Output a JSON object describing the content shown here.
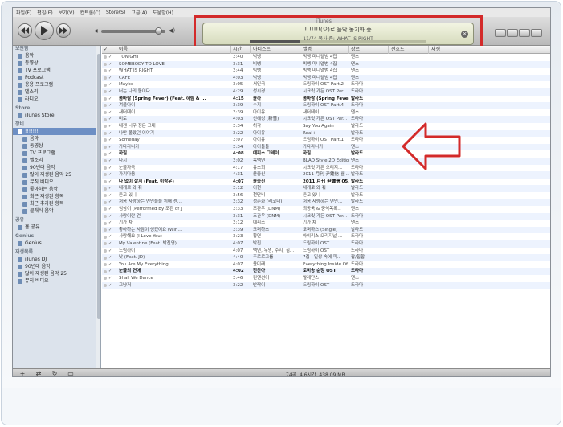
{
  "menu": [
    "파일(F)",
    "편집(E)",
    "보기(V)",
    "컨트롤(C)",
    "Store(S)",
    "고급(A)",
    "도움말(H)"
  ],
  "lcd": {
    "title": "iTunes",
    "line1": "!!!!!!!(으)로 음악 동기화 중",
    "line2": "11/74 복사 중: WHAT IS RIGHT",
    "progress": 0.28
  },
  "sidebar": {
    "sections": [
      {
        "head": "보관함",
        "items": [
          {
            "label": "음악",
            "icon": "music-note-icon"
          },
          {
            "label": "동영상",
            "icon": "film-icon"
          },
          {
            "label": "TV 프로그램",
            "icon": "tv-icon"
          },
          {
            "label": "Podcast",
            "icon": "podcast-icon"
          },
          {
            "label": "응용 프로그램",
            "icon": "apps-icon"
          },
          {
            "label": "벨소리",
            "icon": "bell-icon"
          },
          {
            "label": "라디오",
            "icon": "radio-icon"
          }
        ]
      },
      {
        "head": "Store",
        "items": [
          {
            "label": "iTunes Store",
            "icon": "store-icon"
          }
        ]
      },
      {
        "head": "장비",
        "items": [
          {
            "label": "!!!!!!!",
            "icon": "iphone-icon",
            "selected": true
          },
          {
            "label": "음악",
            "icon": "music-note-icon",
            "sub": true
          },
          {
            "label": "동영상",
            "icon": "film-icon",
            "sub": true
          },
          {
            "label": "TV 프로그램",
            "icon": "tv-icon",
            "sub": true
          },
          {
            "label": "벨소리",
            "icon": "bell-icon",
            "sub": true
          },
          {
            "label": "90년대 음악",
            "icon": "smart-playlist-icon",
            "sub": true
          },
          {
            "label": "많이 재생된 음악 25",
            "icon": "smart-playlist-icon",
            "sub": true
          },
          {
            "label": "뮤직 비디오",
            "icon": "smart-playlist-icon",
            "sub": true
          },
          {
            "label": "좋아하는 음악",
            "icon": "smart-playlist-icon",
            "sub": true
          },
          {
            "label": "최근 재생된 항목",
            "icon": "smart-playlist-icon",
            "sub": true
          },
          {
            "label": "최근 추가된 항목",
            "icon": "smart-playlist-icon",
            "sub": true
          },
          {
            "label": "클래식 음악",
            "icon": "smart-playlist-icon",
            "sub": true
          }
        ]
      },
      {
        "head": "공유",
        "items": [
          {
            "label": "홈 공유",
            "icon": "home-share-icon"
          }
        ]
      },
      {
        "head": "Genius",
        "items": [
          {
            "label": "Genius",
            "icon": "genius-icon"
          }
        ]
      },
      {
        "head": "재생목록",
        "items": [
          {
            "label": "iTunes DJ",
            "icon": "dj-icon"
          },
          {
            "label": "90년대 음악",
            "icon": "smart-playlist-icon"
          },
          {
            "label": "많이 재생된 음악 25",
            "icon": "smart-playlist-icon"
          },
          {
            "label": "뮤직 비디오",
            "icon": "smart-playlist-icon"
          }
        ]
      }
    ]
  },
  "table": {
    "headers": [
      "이름",
      "시간",
      "아티스트",
      "앨범",
      "장르",
      "선호도",
      "재생"
    ],
    "rows": [
      [
        "TONIGHT",
        "3:40",
        "빅뱅",
        "빅뱅 미니앨범 4집",
        "댄스",
        false
      ],
      [
        "SOMEBODY TO LOVE",
        "3:31",
        "빅뱅",
        "빅뱅 미니앨범 4집",
        "댄스",
        false
      ],
      [
        "WHAT IS RIGHT",
        "3:44",
        "빅뱅",
        "빅뱅 미니앨범 4집",
        "댄스",
        false
      ],
      [
        "CAFE",
        "4:03",
        "빅뱅",
        "빅뱅 미니앨범 4집",
        "댄스",
        false
      ],
      [
        "Maybe",
        "3:05",
        "서인국",
        "드림하이 OST Part.2",
        "드라마",
        false
      ],
      [
        "너는 나의 봄이다",
        "4:29",
        "성시경",
        "시크릿 가든 OST Par...",
        "드라마",
        false
      ],
      [
        "봄바람 (Spring Fever) (Feat. 하림 & ...",
        "4:15",
        "윤하",
        "봄바람 (Spring Fever)",
        "발라드",
        true
      ],
      [
        "겨울아이",
        "3:39",
        "수지",
        "드림하이 OST Part.4",
        "드라마",
        false
      ],
      [
        "새터데이",
        "3:39",
        "아이유",
        "새터데이",
        "댄스",
        false
      ],
      [
        "미로",
        "4:03",
        "신혜성 (新彗)",
        "시크릿 가든 OST Par...",
        "드라마",
        false
      ],
      [
        "내겐 너무 정든 그대",
        "3:34",
        "허각",
        "Say You Again",
        "발라드",
        false
      ],
      [
        "나만 몰랐던 이야기",
        "3:22",
        "아이유",
        "Real+",
        "발라드",
        false
      ],
      [
        "Someday",
        "3:07",
        "아이유",
        "드림하이 OST Part.1",
        "드라마",
        false
      ],
      [
        "가다라니카",
        "3:34",
        "아이돌들",
        "가다라니카",
        "댄스",
        false
      ],
      [
        "하필",
        "4:08",
        "에피소 그레이",
        "하필",
        "발라드",
        true
      ],
      [
        "다시",
        "3:02",
        "옥택연",
        "BLAQ Style 2D Edition",
        "댄스",
        false
      ],
      [
        "눈물자국",
        "4:17",
        "유소희",
        "시크릿 가든 오리지...",
        "드라마",
        false
      ],
      [
        "가기마음",
        "4:31",
        "윤종신",
        "2011 月刊 尹鍾信 월...",
        "발라드",
        false
      ],
      [
        "나 없이 살지 (Feat. 이랑우)",
        "4:07",
        "윤종신",
        "2011 月刊 尹鍾信 05...",
        "발라드",
        true
      ],
      [
        "내게로 와 줘",
        "3:12",
        "이현",
        "내게로 와 줘",
        "발라드",
        false
      ],
      [
        "듣고 있니",
        "3:56",
        "천단비",
        "듣고 있니",
        "발라드",
        false
      ],
      [
        "처음 사랑하는 연인들을 위해 센...",
        "3:32",
        "정준화 (리코더)",
        "처음 사랑하는 연인...",
        "발라드",
        false
      ],
      [
        "임삼이 (Performed By 조관 of J",
        "3:33",
        "조관우 (DNM)",
        "최동욱 & 중식목록...",
        "댄스",
        false
      ],
      [
        "사랑이란 건",
        "3:31",
        "조관우 (DNM)",
        "시크릿 가든 OST Par...",
        "드라마",
        false
      ],
      [
        "기가 차",
        "3:12",
        "에피소",
        "기가 차",
        "댄스",
        false
      ],
      [
        "좋아하는 사람이 생겼어요 (Win...",
        "3:39",
        "코퍼하스",
        "코퍼하스 (Single)",
        "발라드",
        false
      ],
      [
        "사랑해요 (I Love You)",
        "3:23",
        "황연",
        "아이리스 오리지널 ...",
        "드라마",
        false
      ],
      [
        "My Valentine (Feat. 박진영)",
        "4:07",
        "박진",
        "드림하이 OST",
        "드라마",
        false
      ],
      [
        "드림하이",
        "4:07",
        "택연, 우영, 수지, 김...",
        "드림하이 OST",
        "드라마",
        false
      ],
      [
        "낮 (Feat. JD)",
        "4:40",
        "주르르그룹",
        "7집 - 일상 속에 피...",
        "팝/힙합",
        false
      ],
      [
        "You Are My Everything",
        "4:07",
        "윤미래",
        "Everything Inside Of ...",
        "드라마",
        false
      ],
      [
        "눈물의 연애",
        "4:02",
        "진찬아",
        "로비송 순정 OST",
        "드라마",
        true
      ],
      [
        "Shall We Dance",
        "3:46",
        "린앤선이",
        "발레단스",
        "댄스",
        false
      ],
      [
        "그냥저",
        "3:22",
        "반짝이",
        "드림하이 OST",
        "드라마",
        false
      ]
    ]
  },
  "status": "74곡, 4.6시간, 438.09 MB",
  "accent_colors": {
    "annotation_red": "#d32a2a",
    "selection_blue": "#6d8fc4"
  }
}
